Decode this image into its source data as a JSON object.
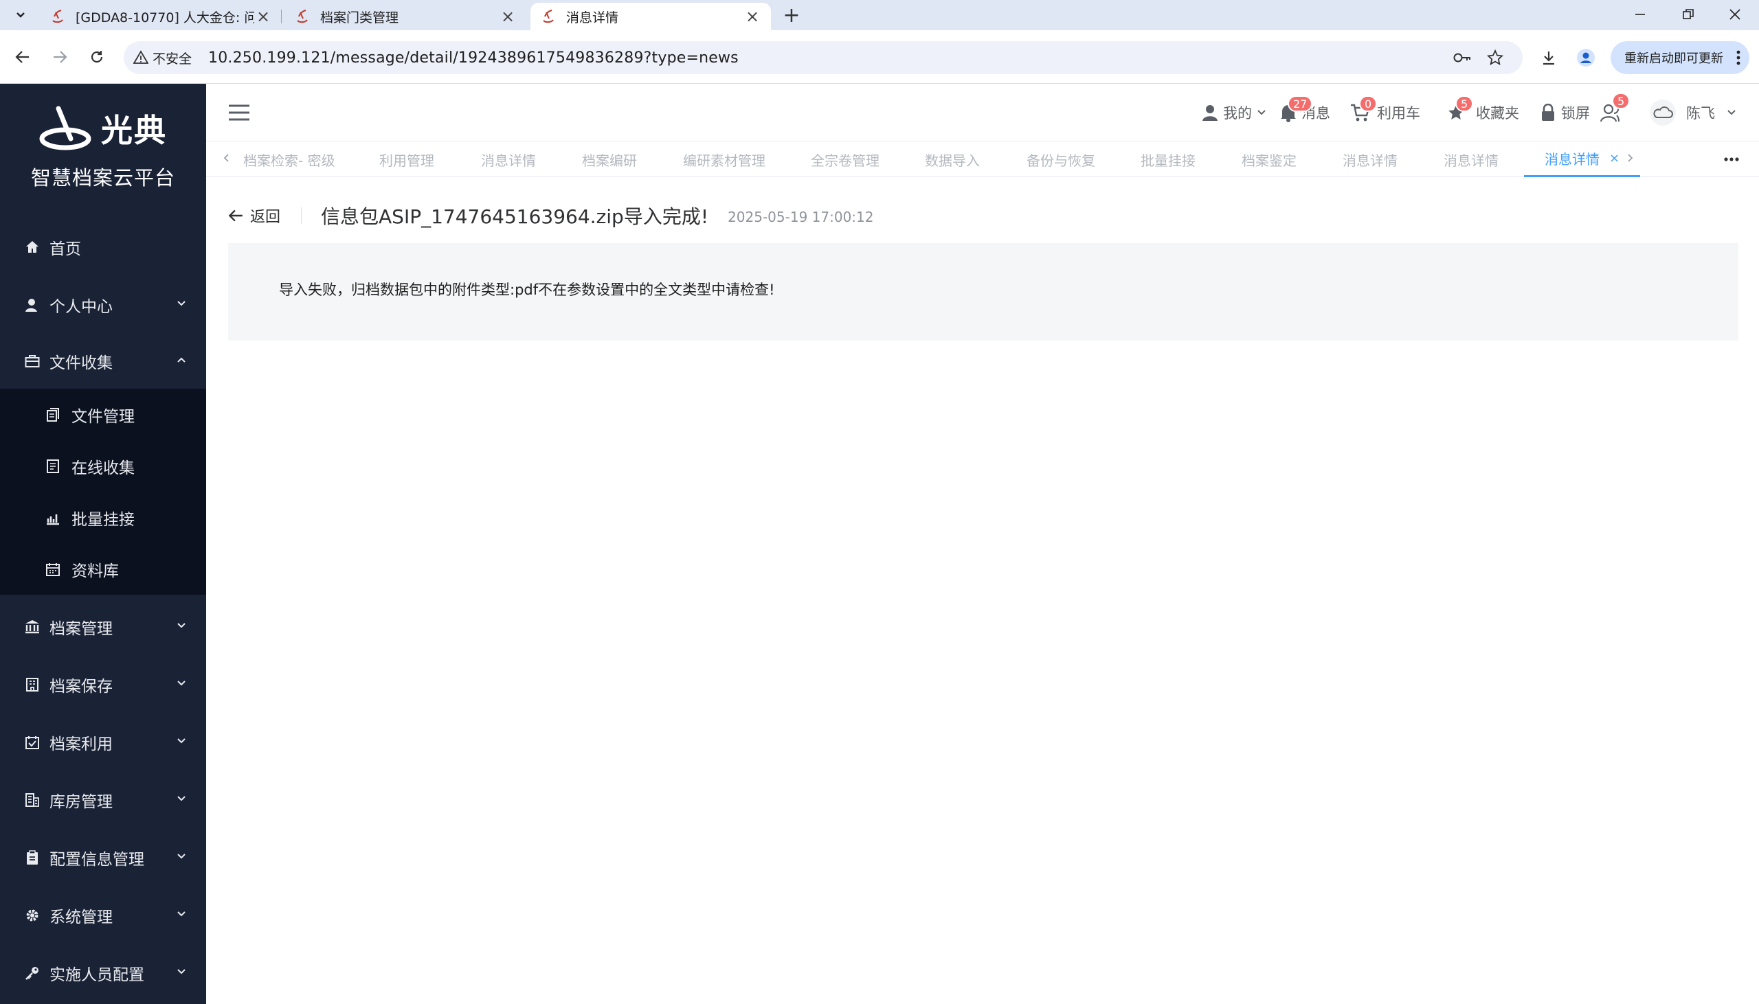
{
  "browser": {
    "tabs": [
      {
        "title": "[GDDA8-10770] 人大金仓: 问",
        "active": false
      },
      {
        "title": "档案门类管理",
        "active": false
      },
      {
        "title": "消息详情",
        "active": true
      }
    ],
    "security_label": "不安全",
    "url": "10.250.199.121/message/detail/1924389617549836289?type=news",
    "update_button": "重新启动即可更新"
  },
  "sidebar": {
    "brand": "光典",
    "platform_name": "智慧档案云平台",
    "menu": [
      {
        "label": "首页",
        "icon": "home-icon"
      },
      {
        "label": "个人中心",
        "icon": "user-icon",
        "expanded": false
      },
      {
        "label": "文件收集",
        "icon": "briefcase-icon",
        "expanded": true
      },
      {
        "label": "档案管理",
        "icon": "bank-icon",
        "expanded": false
      },
      {
        "label": "档案保存",
        "icon": "building-icon",
        "expanded": false
      },
      {
        "label": "档案利用",
        "icon": "calendar-check-icon",
        "expanded": false
      },
      {
        "label": "库房管理",
        "icon": "warehouse-icon",
        "expanded": false
      },
      {
        "label": "配置信息管理",
        "icon": "clipboard-icon",
        "expanded": false
      },
      {
        "label": "系统管理",
        "icon": "gear-icon",
        "expanded": false
      },
      {
        "label": "实施人员配置",
        "icon": "key-icon",
        "expanded": false
      }
    ],
    "submenu": [
      {
        "label": "文件管理",
        "icon": "files-icon"
      },
      {
        "label": "在线收集",
        "icon": "document-icon"
      },
      {
        "label": "批量挂接",
        "icon": "bar-chart-icon"
      },
      {
        "label": "资料库",
        "icon": "calendar-icon"
      }
    ]
  },
  "header": {
    "mine": "我的",
    "messages": {
      "label": "消息",
      "count": "27"
    },
    "cart": {
      "label": "利用车",
      "count": "0"
    },
    "favorites": {
      "label": "收藏夹",
      "count": "5"
    },
    "lock": "锁屏",
    "user_count": "5",
    "username": "陈飞"
  },
  "tagsview": {
    "tags": [
      "档案检索- 密级",
      "利用管理",
      "消息详情",
      "档案编研",
      "编研素材管理",
      "全宗卷管理",
      "数据导入",
      "备份与恢复",
      "批量挂接",
      "档案鉴定",
      "消息详情",
      "消息详情",
      "消息详情"
    ],
    "close_glyph": "×"
  },
  "main": {
    "back_label": "返回",
    "title": "信息包ASIP_1747645163964.zip导入完成!",
    "time": "2025-05-19 17:00:12",
    "content": "导入失败，归档数据包中的附件类型:pdf不在参数设置中的全文类型中请检查!"
  },
  "colors": {
    "sidebar_bg": "#1a2236",
    "submenu_bg": "#0c1120",
    "accent": "#409eff",
    "badge": "#f56c6c"
  }
}
